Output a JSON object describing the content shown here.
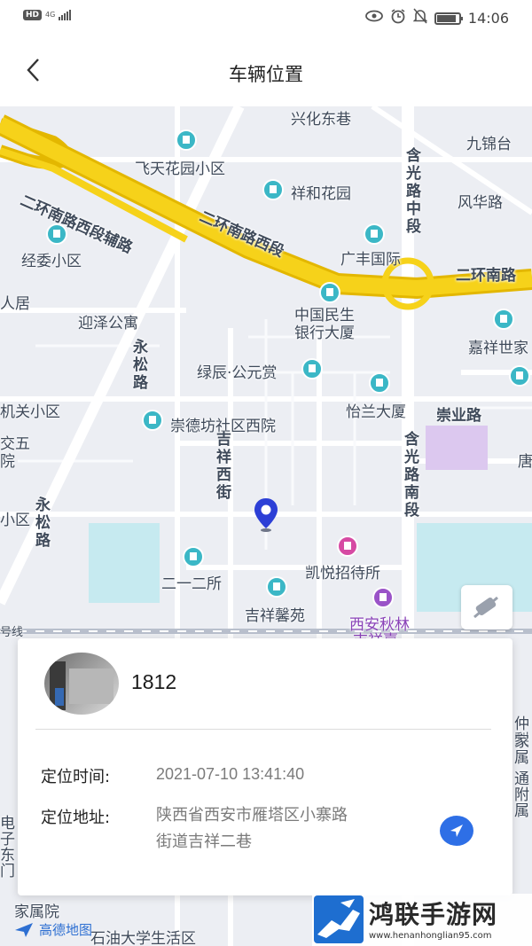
{
  "status_bar": {
    "hd": "HD",
    "network": "4G",
    "time": "14:06",
    "icons": [
      "eye-icon",
      "alarm-icon",
      "mute-icon",
      "battery-icon"
    ]
  },
  "header": {
    "title": "车辆位置",
    "back_icon": "chevron-left-icon"
  },
  "map": {
    "labels": [
      "兴化东巷",
      "九锦台",
      "飞天花园小区",
      "二环南路西段辅路",
      "祥和花园",
      "含光路中段",
      "风华路",
      "经委小区",
      "二环南路西段",
      "广丰国际",
      "二环南路",
      "人居",
      "中国民生银行大厦",
      "迎泽公寓",
      "永松路",
      "嘉祥世家",
      "绿辰·公元赏",
      "机关小区",
      "怡兰大厦",
      "崇业路",
      "崇德坊社区西院",
      "吉祥西街",
      "含光路南段",
      "交五",
      "院",
      "唐",
      "小区",
      "永松路",
      "凯悦招待所",
      "二一二所",
      "吉祥馨苑",
      "西安秋林",
      "吉祥嘉",
      "号线",
      "仲梨",
      "家属",
      "通附",
      "附属",
      "电子",
      "东门",
      "家属院",
      "石油大学生活区"
    ],
    "logo": "高德地图",
    "layer_icon": "layers-icon",
    "pin_icon": "location-pin-icon"
  },
  "vehicle": {
    "name": "1812",
    "time_label": "定位时间:",
    "time_value": "2021-07-10 13:41:40",
    "address_label": "定位地址:",
    "address_line1": "陕西省西安市雁塔区小寨路",
    "address_line2": "街道吉祥二巷",
    "navigate_icon": "navigate-arrow-icon"
  },
  "watermark": {
    "title": "鸿联手游网",
    "url": "www.henanhonglian95.com"
  },
  "colors": {
    "accent_blue": "#2e6fe6",
    "highway_yellow": "#f6d21a",
    "poi_teal": "#3bb7c6"
  }
}
